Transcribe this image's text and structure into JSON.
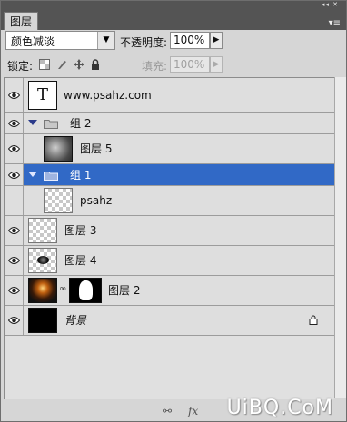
{
  "panel": {
    "tab_label": "图层",
    "collapse_glyph": "◂◂ ✕",
    "menu_glyph": "▾≡"
  },
  "blend_mode": {
    "value": "颜色减淡"
  },
  "opacity": {
    "label": "不透明度:",
    "value": "100%"
  },
  "lock": {
    "label": "锁定:",
    "icons": [
      "lock-transparency-icon",
      "lock-pixels-icon",
      "lock-position-icon",
      "lock-all-icon"
    ]
  },
  "fill": {
    "label": "填充:",
    "value": "100%"
  },
  "layers": [
    {
      "name": "www.psahz.com",
      "kind": "text",
      "thumb_glyph": "T"
    },
    {
      "name": "组 2",
      "kind": "group"
    },
    {
      "name": "图层 5",
      "kind": "layer",
      "in_group": true
    },
    {
      "name": "组 1",
      "kind": "group",
      "selected": true
    },
    {
      "name": "psahz",
      "kind": "layer",
      "in_group": true
    },
    {
      "name": "图层 3",
      "kind": "layer"
    },
    {
      "name": "图层 4",
      "kind": "layer"
    },
    {
      "name": "图层 2",
      "kind": "masked-layer"
    },
    {
      "name": "背景",
      "kind": "background",
      "locked": true
    }
  ],
  "bottom_bar": {
    "fx_label": "fx"
  },
  "watermark": {
    "text": "UiBQ.CoM"
  }
}
